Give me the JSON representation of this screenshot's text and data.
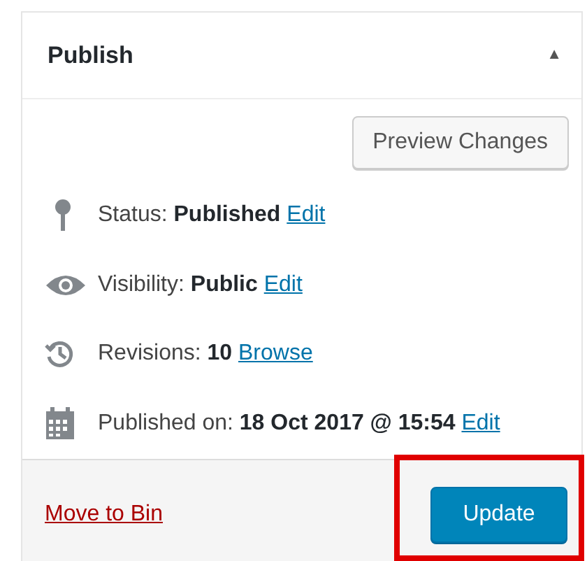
{
  "panel": {
    "title": "Publish",
    "toggle": "▲",
    "expanded": true
  },
  "preview_button": "Preview Changes",
  "rows": [
    {
      "kind": "status",
      "label": "Status:",
      "value": "Published",
      "link": "Edit"
    },
    {
      "kind": "visibility",
      "label": "Visibility:",
      "value": "Public",
      "link": "Edit"
    },
    {
      "kind": "revisions",
      "label": "Revisions:",
      "value": "10",
      "link": "Browse"
    },
    {
      "kind": "date",
      "label": "Published on:",
      "value": "18 Oct 2017 @ 15:54",
      "link": "Edit"
    }
  ],
  "footer": {
    "trash_link": "Move to Bin",
    "primary_button": "Update"
  }
}
